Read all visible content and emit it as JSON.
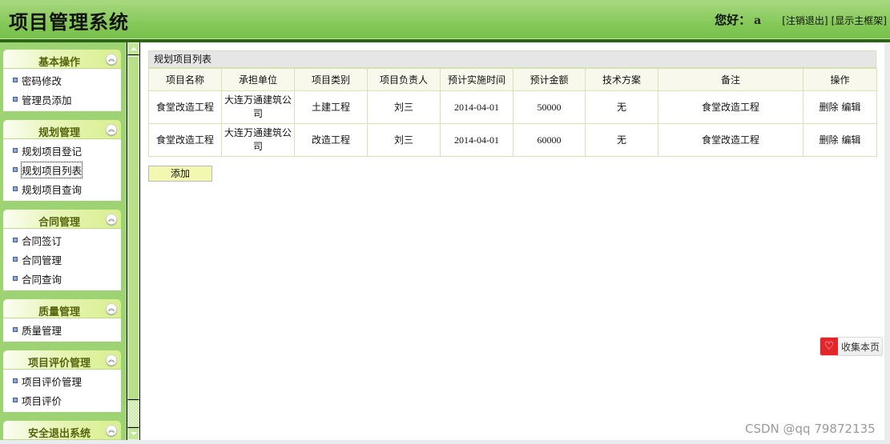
{
  "header": {
    "app_title": "项目管理系统",
    "greeting": "您好：",
    "username": "a",
    "logout_link": "[注销退出]",
    "show_frame_link": "[显示主框架]"
  },
  "sidebar": {
    "groups": [
      {
        "title": "基本操作",
        "collapse_icon": "double-chevron-up-icon",
        "items": [
          {
            "label": "密码修改"
          },
          {
            "label": "管理员添加"
          }
        ]
      },
      {
        "title": "规划管理",
        "collapse_icon": "double-chevron-up-icon",
        "items": [
          {
            "label": "规划项目登记"
          },
          {
            "label": "规划项目列表",
            "active": true
          },
          {
            "label": "规划项目查询"
          }
        ]
      },
      {
        "title": "合同管理",
        "collapse_icon": "double-chevron-up-icon",
        "items": [
          {
            "label": "合同签订"
          },
          {
            "label": "合同管理"
          },
          {
            "label": "合同查询"
          }
        ]
      },
      {
        "title": "质量管理",
        "collapse_icon": "double-chevron-up-icon",
        "items": [
          {
            "label": "质量管理"
          }
        ]
      },
      {
        "title": "项目评价管理",
        "collapse_icon": "double-chevron-up-icon",
        "items": [
          {
            "label": "项目评价管理"
          },
          {
            "label": "项目评价"
          }
        ]
      },
      {
        "title": "安全退出系统",
        "collapse_icon": "double-chevron-up-icon",
        "items": []
      }
    ],
    "collapse_glyph": "≈"
  },
  "main": {
    "panel_title": "规划项目列表",
    "columns": [
      "项目名称",
      "承担单位",
      "项目类别",
      "项目负责人",
      "预计实施时间",
      "预计金额",
      "技术方案",
      "备注",
      "操作"
    ],
    "rows": [
      {
        "name": "食堂改造工程",
        "unit": "大连万通建筑公司",
        "category": "土建工程",
        "manager": "刘三",
        "date": "2014-04-01",
        "amount": "50000",
        "plan": "无",
        "remark": "食堂改造工程",
        "delete": "删除",
        "edit": "编辑"
      },
      {
        "name": "食堂改造工程",
        "unit": "大连万通建筑公司",
        "category": "改造工程",
        "manager": "刘三",
        "date": "2014-04-01",
        "amount": "60000",
        "plan": "无",
        "remark": "食堂改造工程",
        "delete": "删除",
        "edit": "编辑"
      }
    ],
    "add_button": "添加"
  },
  "bookmark": {
    "label": "收集本页",
    "icon": "heart-icon",
    "icon_glyph": "♡"
  },
  "watermark": "CSDN @qq 79872135",
  "colors": {
    "header_green": "#86c95a",
    "header_bar": "#2b6614",
    "sidebar_bg": "#9ed373",
    "menu_title": "#55650c",
    "add_button_bg": "#f2f8b2",
    "bookmark_red": "#e3262a"
  }
}
